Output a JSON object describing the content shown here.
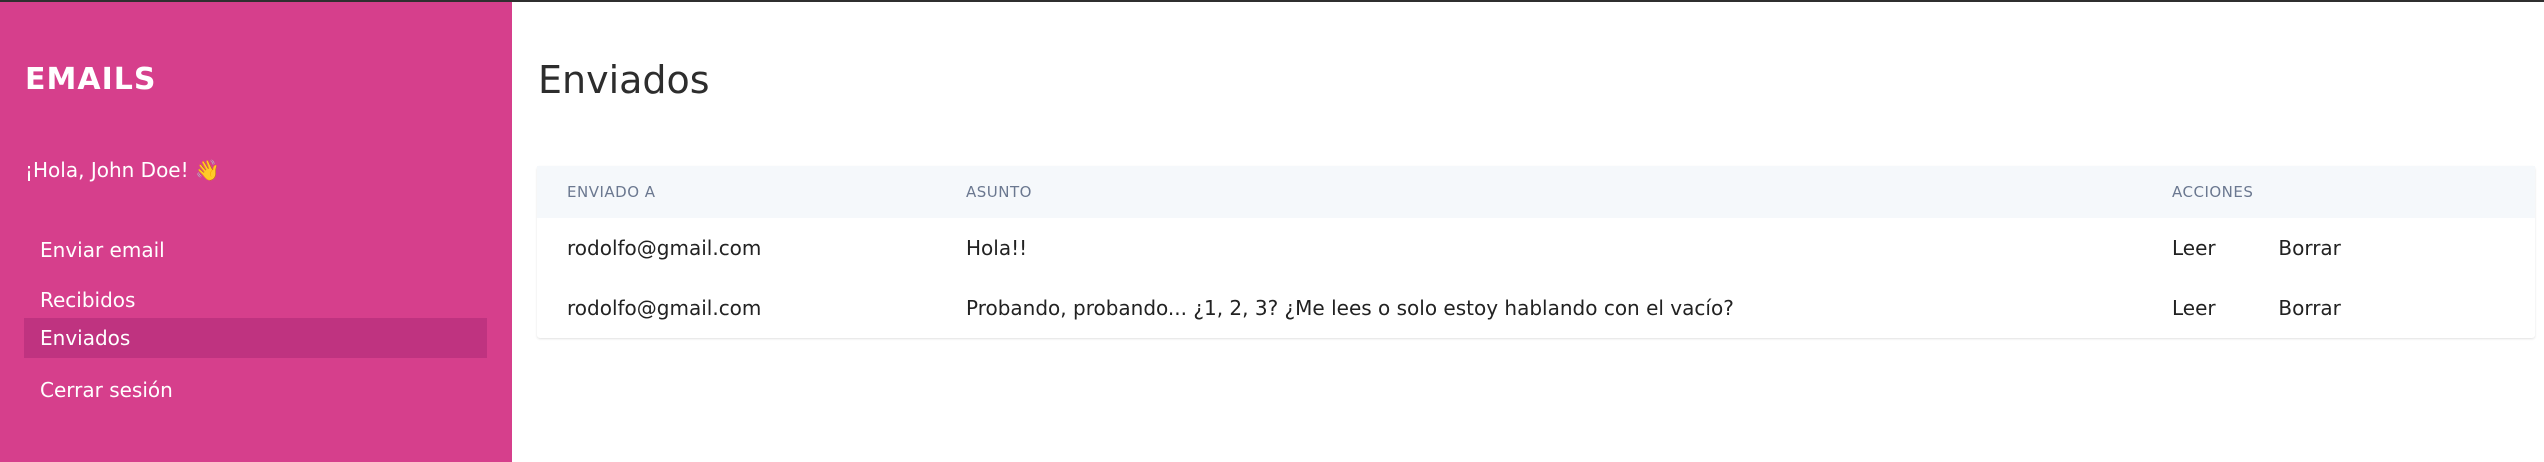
{
  "sidebar": {
    "brand": "EMAILS",
    "greeting": "¡Hola, John Doe! 👋",
    "items": [
      {
        "label": "Enviar email"
      },
      {
        "label": "Recibidos"
      },
      {
        "label": "Enviados",
        "active": true
      },
      {
        "label": "Cerrar sesión"
      }
    ]
  },
  "main": {
    "title": "Enviados",
    "table": {
      "headers": [
        "ENVIADO A",
        "ASUNTO",
        "ACCIONES"
      ],
      "rows": [
        {
          "to": "rodolfo@gmail.com",
          "subject": "Hola!!",
          "read_label": "Leer",
          "delete_label": "Borrar"
        },
        {
          "to": "rodolfo@gmail.com",
          "subject": "Probando, probando... ¿1, 2, 3? ¿Me lees o solo estoy hablando con el vacío?",
          "read_label": "Leer",
          "delete_label": "Borrar"
        }
      ]
    }
  },
  "colors": {
    "sidebar_bg": "#d63f8c",
    "sidebar_active": "#bf3380",
    "table_header_bg": "#f5f8fb"
  }
}
